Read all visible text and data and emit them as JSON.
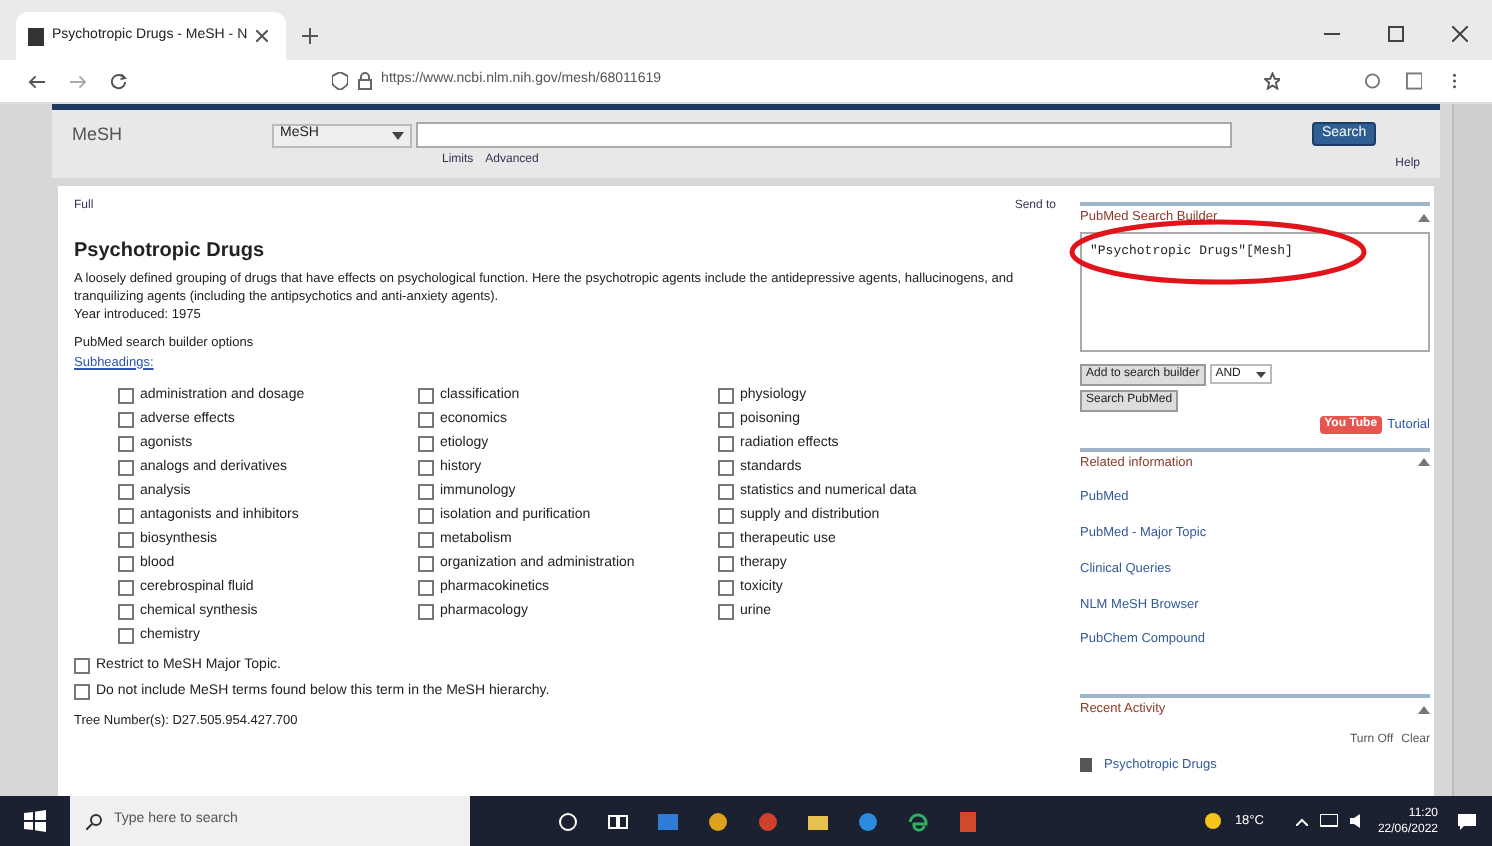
{
  "browser": {
    "tab_title": "Psychotropic Drugs - MeSH - N",
    "url": "https://www.ncbi.nlm.nih.gov/mesh/68011619"
  },
  "header": {
    "db_label": "MeSH",
    "db_select": "MeSH",
    "search_button": "Search",
    "links": [
      "Limits",
      "Advanced"
    ],
    "help": "Help"
  },
  "content": {
    "format": "Full",
    "send_to": "Send to",
    "title": "Psychotropic Drugs",
    "description": "A loosely defined grouping of drugs that have effects on psychological function. Here the psychotropic agents include the antidepressive agents, hallucinogens, and tranquilizing agents (including the antipsychotics and anti-anxiety agents).",
    "year": "Year introduced: 1975",
    "builder_options": "PubMed search builder options",
    "subheadings_link": "Subheadings:",
    "subheadings": [
      [
        {
          "label": "administration and dosage",
          "checked": false
        },
        {
          "label": "adverse effects",
          "checked": false
        },
        {
          "label": "agonists",
          "checked": false
        },
        {
          "label": "analogs and derivatives",
          "checked": false
        },
        {
          "label": "analysis",
          "checked": false
        },
        {
          "label": "antagonists and inhibitors",
          "checked": false
        },
        {
          "label": "biosynthesis",
          "checked": false
        },
        {
          "label": "blood",
          "checked": false
        },
        {
          "label": "cerebrospinal fluid",
          "checked": false
        },
        {
          "label": "chemical synthesis",
          "checked": false
        },
        {
          "label": "chemistry",
          "checked": false
        }
      ],
      [
        {
          "label": "classification",
          "checked": false
        },
        {
          "label": "economics",
          "checked": false
        },
        {
          "label": "etiology",
          "checked": false
        },
        {
          "label": "history",
          "checked": false
        },
        {
          "label": "immunology",
          "checked": false
        },
        {
          "label": "isolation and purification",
          "checked": false
        },
        {
          "label": "metabolism",
          "checked": false
        },
        {
          "label": "organization and administration",
          "checked": false
        },
        {
          "label": "pharmacokinetics",
          "checked": false
        },
        {
          "label": "pharmacology",
          "checked": false
        }
      ],
      [
        {
          "label": "physiology",
          "checked": false
        },
        {
          "label": "poisoning",
          "checked": false
        },
        {
          "label": "radiation effects",
          "checked": false
        },
        {
          "label": "standards",
          "checked": false
        },
        {
          "label": "statistics and numerical data",
          "checked": false
        },
        {
          "label": "supply and distribution",
          "checked": false
        },
        {
          "label": "therapeutic use",
          "checked": false
        },
        {
          "label": "therapy",
          "checked": false
        },
        {
          "label": "toxicity",
          "checked": false
        },
        {
          "label": "urine",
          "checked": false
        }
      ]
    ],
    "options": [
      {
        "label": "Restrict to MeSH Major Topic.",
        "checked": false
      },
      {
        "label": "Do not include MeSH terms found below this term in the MeSH hierarchy.",
        "checked": false
      }
    ],
    "tree_numbers": "Tree Number(s): D27.505.954.427.700"
  },
  "sidebar": {
    "builder_title": "PubMed Search Builder",
    "query": "\"Psychotropic Drugs\"[Mesh]",
    "add_button": "Add to search builder",
    "operator": "AND",
    "search_pubmed": "Search PubMed",
    "youtube": "You Tube",
    "tutorial": "Tutorial",
    "related_title": "Related information",
    "related": [
      "PubMed",
      "PubMed - Major Topic",
      "Clinical Queries",
      "NLM MeSH Browser",
      "PubChem Compound"
    ],
    "recent_title": "Recent Activity",
    "turn_off": "Turn Off",
    "clear": "Clear",
    "recent": [
      "Psychotropic Drugs"
    ]
  },
  "taskbar": {
    "search_placeholder": "Type here to search",
    "weather": "18°C",
    "time": "11:20",
    "date": "22/06/2022"
  }
}
